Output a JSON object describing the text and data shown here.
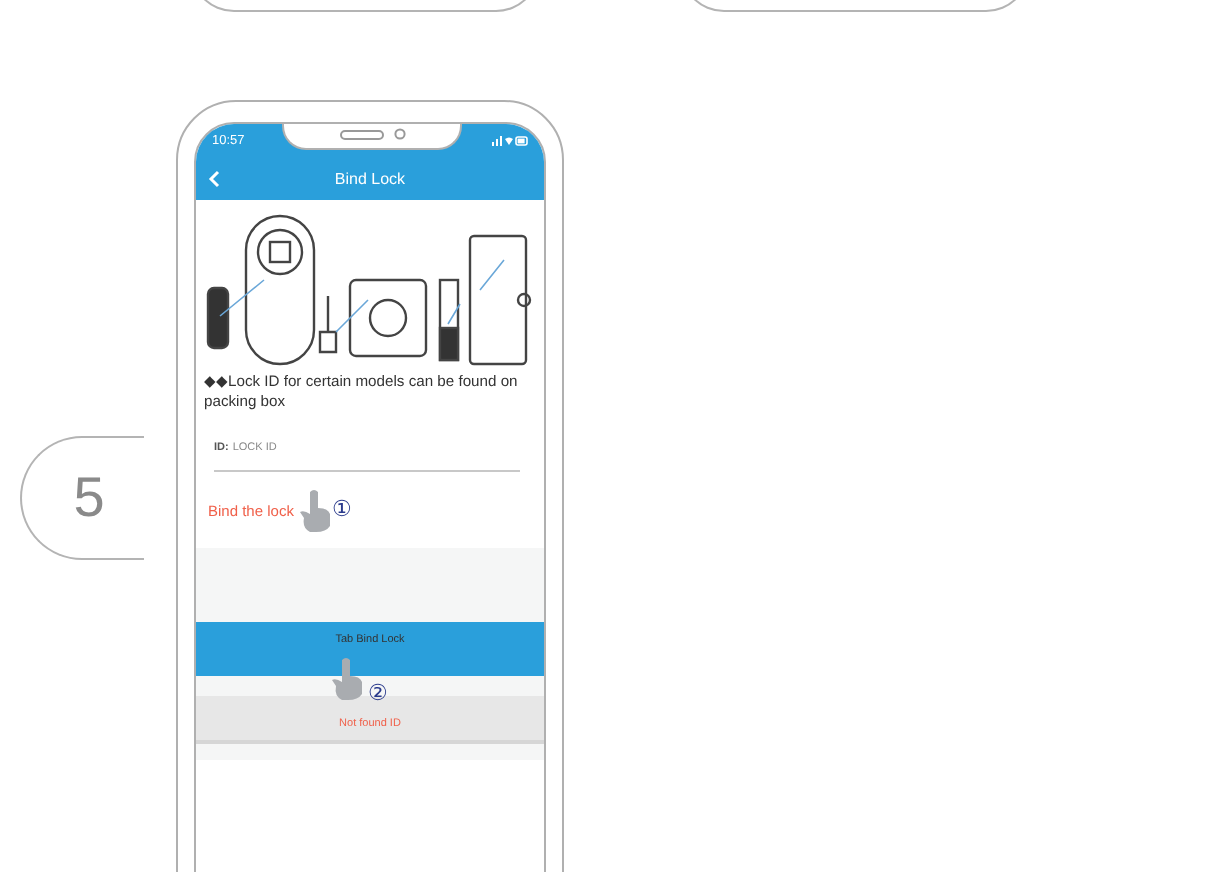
{
  "step": "5",
  "status_bar": {
    "time": "10:57"
  },
  "header": {
    "title": "Bind Lock"
  },
  "note": "◆◆Lock ID for certain models can be found on packing box",
  "id_field": {
    "label": "ID:",
    "placeholder": "LOCK ID"
  },
  "bind_hint": "Bind the lock",
  "buttons": [
    {
      "label": "Tab Bind Lock",
      "kind": "primary"
    },
    {
      "label": "Not found ID",
      "kind": "secondary"
    }
  ],
  "callouts": [
    "①",
    "②"
  ]
}
